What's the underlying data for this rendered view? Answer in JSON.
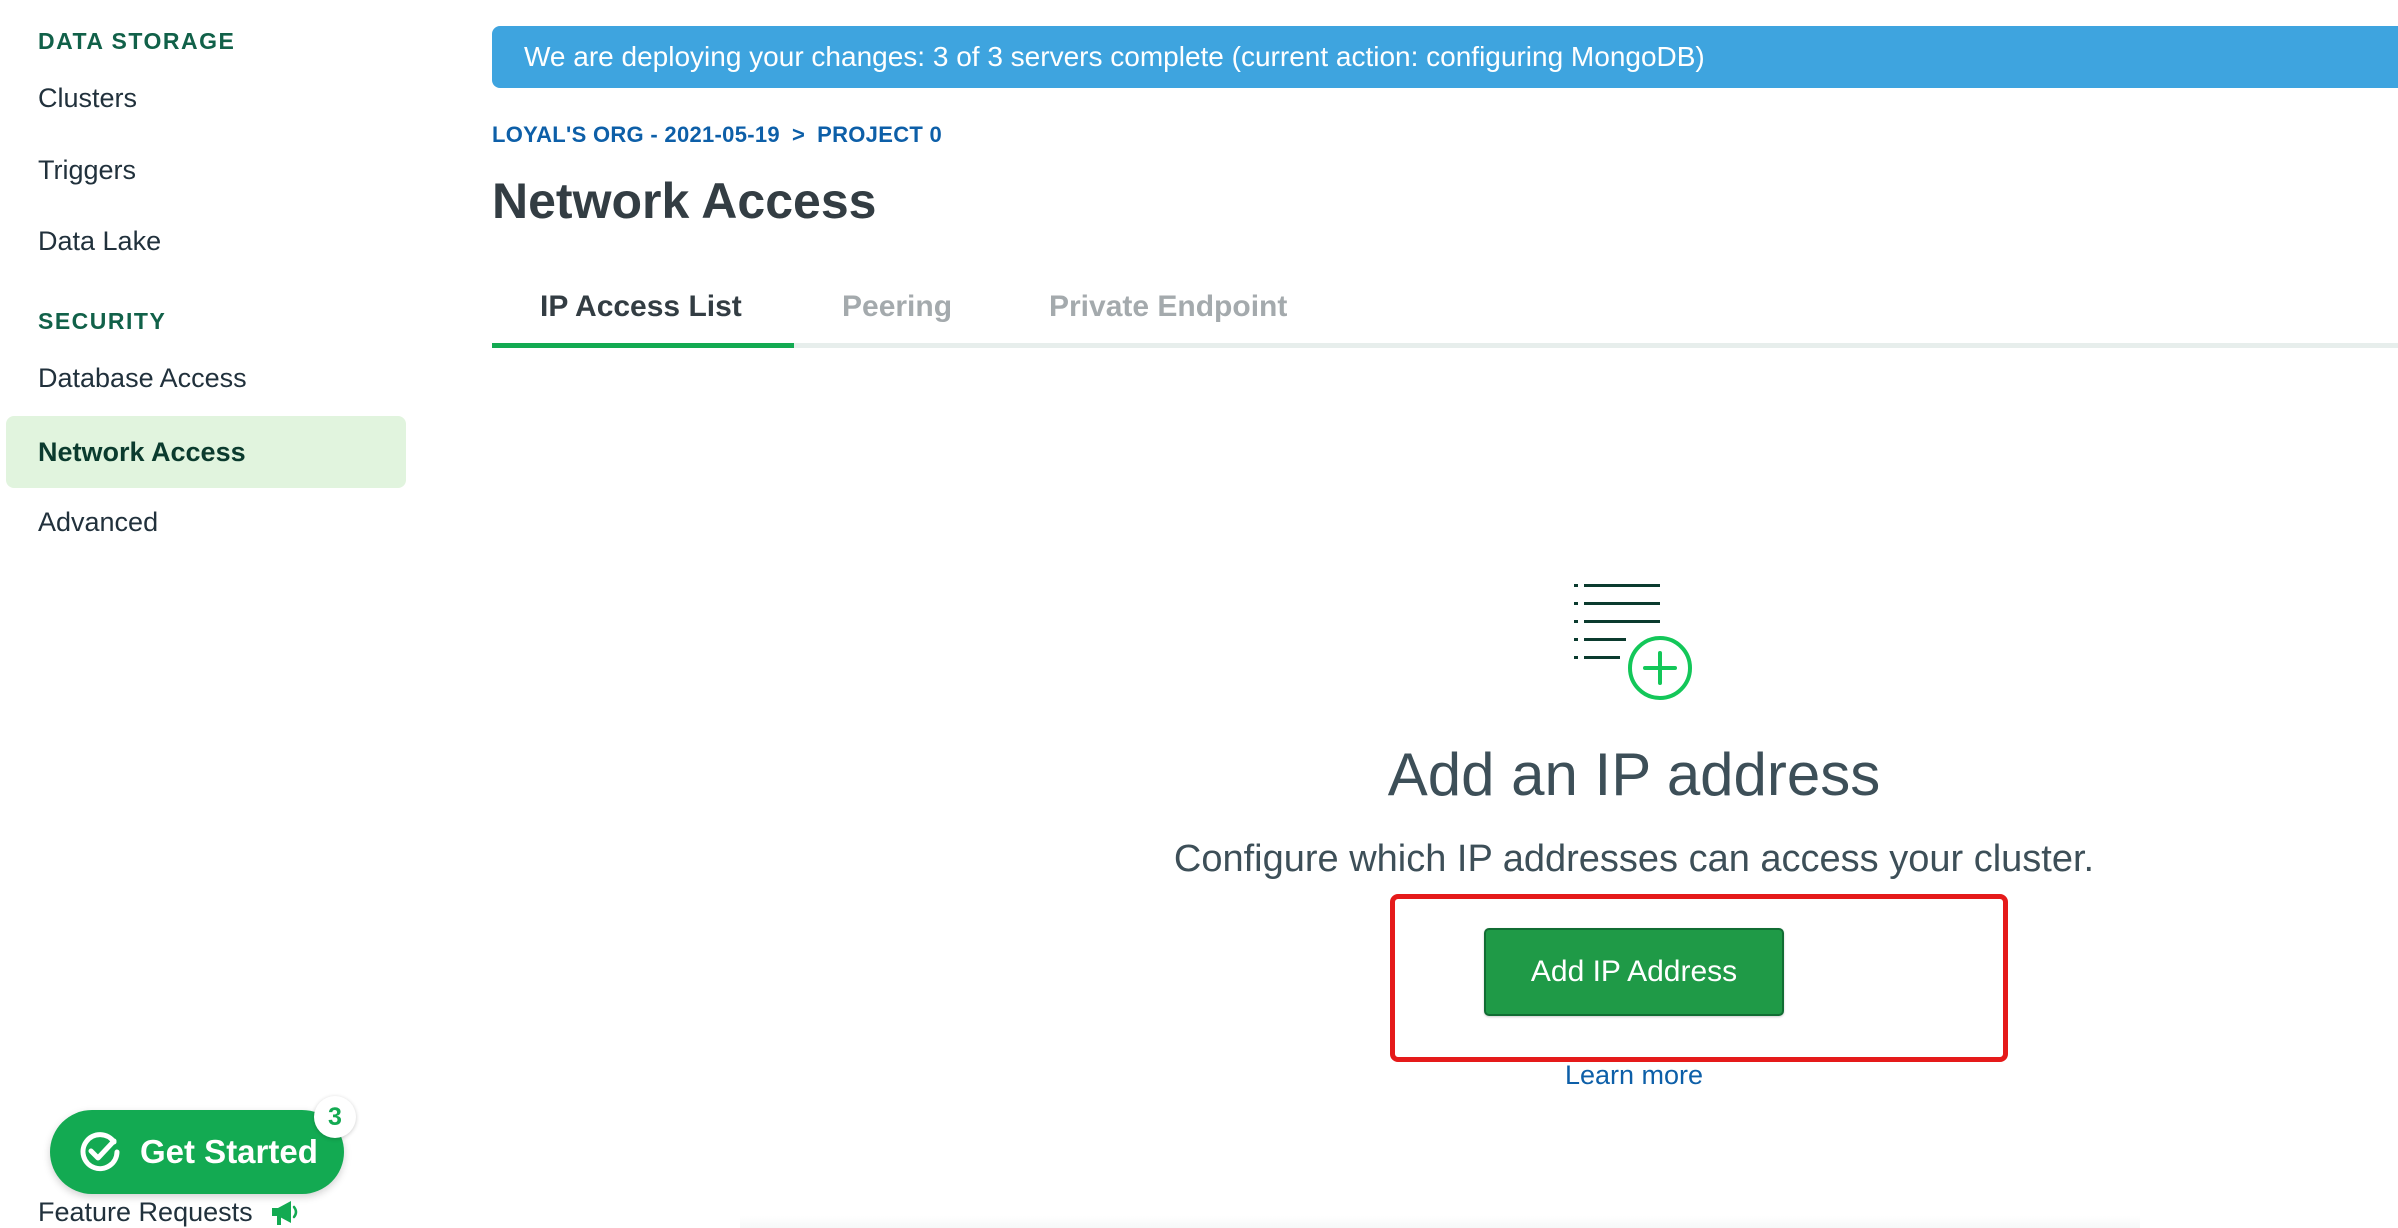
{
  "sidebar": {
    "sections": [
      {
        "title": "DATA STORAGE",
        "items": [
          {
            "label": "Clusters"
          },
          {
            "label": "Triggers"
          },
          {
            "label": "Data Lake"
          }
        ]
      },
      {
        "title": "SECURITY",
        "items": [
          {
            "label": "Database Access"
          },
          {
            "label": "Network Access",
            "active": true
          },
          {
            "label": "Advanced"
          }
        ]
      }
    ],
    "get_started": {
      "label": "Get Started",
      "badge": "3",
      "icon": "check-circle-icon"
    },
    "feature_requests": {
      "label": "Feature Requests",
      "icon": "megaphone-icon"
    }
  },
  "banner": {
    "text": "We are deploying your changes: 3 of 3 servers complete (current action: configuring MongoDB)"
  },
  "breadcrumb": {
    "org": "LOYAL'S ORG - 2021-05-19",
    "separator": ">",
    "project": "PROJECT 0"
  },
  "page": {
    "title": "Network Access"
  },
  "tabs": [
    {
      "label": "IP Access List",
      "active": true
    },
    {
      "label": "Peering"
    },
    {
      "label": "Private Endpoint"
    }
  ],
  "empty_state": {
    "icon": "list-add-icon",
    "title": "Add an IP address",
    "subtitle": "Configure which IP addresses can access your cluster.",
    "button_label": "Add IP Address",
    "learn_more": "Learn more"
  },
  "colors": {
    "brand_green": "#13aa52",
    "banner_blue": "#3ea4df",
    "link_blue": "#0d5fa8",
    "highlight_red": "#e51a1a",
    "active_nav_bg": "#e1f4de"
  }
}
